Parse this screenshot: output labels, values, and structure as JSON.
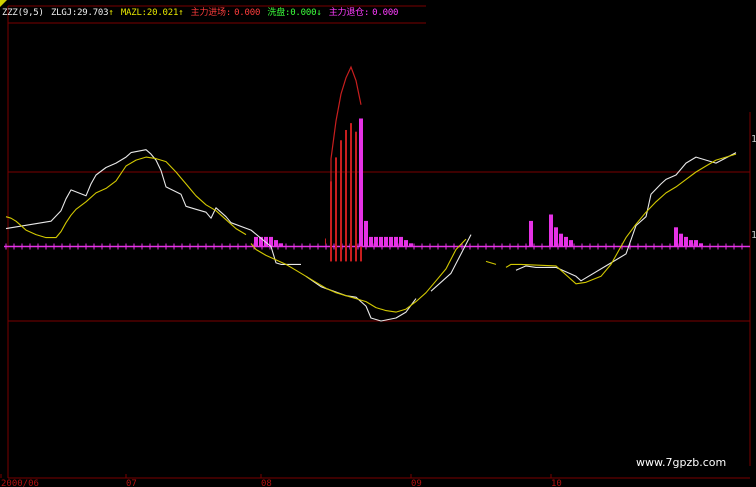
{
  "legend": {
    "indicator_name": "ZZZ(9,5)",
    "zlgj_label": "ZLGJ:",
    "zlgj_value": "29.703",
    "zlgj_arrow": "↑",
    "mazl_label": "MAZL:",
    "mazl_value": "20.021",
    "mazl_arrow": "↑",
    "main_force_entry_label": "主力进场:",
    "main_force_entry_value": "0.000",
    "flow_label": "洗盘:",
    "flow_value": "0.000",
    "flow_arrow": "↓",
    "main_force_exit_label": "主力退仓:",
    "main_force_exit_value": "0.000"
  },
  "x_axis": {
    "tick_labels": [
      "2000/06",
      "07",
      "08",
      "09",
      "10"
    ]
  },
  "right_axis": {
    "labels": [
      "1",
      "1"
    ]
  },
  "watermark": "www.7gpzb.com",
  "colors": {
    "background": "#000000",
    "white_line": "#e8e8e8",
    "yellow_line": "#d2c800",
    "red_bars": "#c81e1e",
    "magenta_bars": "#e632e6",
    "grid_red": "#7a0000",
    "legend_white": "#f0f0f0",
    "legend_yellow": "#e6e600",
    "legend_red": "#ff3c3c",
    "legend_green": "#3cff3c",
    "legend_magenta": "#ff3cff"
  },
  "chart_data": {
    "type": "line",
    "title": "",
    "x_tick_labels": [
      "2000/06",
      "07",
      "08",
      "09",
      "10"
    ],
    "levels": [
      100,
      50,
      0
    ],
    "series": [
      {
        "name": "ZLGJ",
        "color": "#e8e8e8",
        "points": [
          [
            0,
            62
          ],
          [
            9,
            67
          ],
          [
            11,
            74
          ],
          [
            12,
            82
          ],
          [
            13,
            88
          ],
          [
            16,
            84
          ],
          [
            17,
            92
          ],
          [
            18,
            98
          ],
          [
            20,
            103
          ],
          [
            22,
            106
          ],
          [
            24,
            110
          ],
          [
            25,
            113
          ],
          [
            28,
            115
          ],
          [
            29,
            112
          ],
          [
            30,
            108
          ],
          [
            31,
            101
          ],
          [
            32,
            90
          ],
          [
            35,
            85
          ],
          [
            36,
            77
          ],
          [
            38,
            75
          ],
          [
            40,
            73
          ],
          [
            41,
            69
          ],
          [
            42,
            76
          ],
          [
            44,
            70
          ],
          [
            45,
            66
          ],
          [
            49,
            61
          ],
          [
            53,
            50
          ],
          [
            54,
            39
          ],
          [
            55,
            38
          ],
          [
            59,
            38
          ],
          [
            60,
            30
          ],
          [
            63,
            23
          ],
          [
            68,
            17
          ],
          [
            70,
            16
          ],
          [
            72,
            10
          ],
          [
            73,
            2
          ],
          [
            75,
            0
          ],
          [
            78,
            2
          ],
          [
            80,
            6
          ],
          [
            82,
            15
          ],
          [
            85,
            20
          ],
          [
            89,
            32
          ],
          [
            93,
            58
          ],
          [
            95,
            42
          ],
          [
            102,
            34
          ],
          [
            104,
            37
          ],
          [
            106,
            36
          ],
          [
            110,
            36
          ],
          [
            114,
            30
          ],
          [
            115,
            27
          ],
          [
            120,
            37
          ],
          [
            124,
            45
          ],
          [
            126,
            64
          ],
          [
            128,
            70
          ],
          [
            129,
            85
          ],
          [
            131,
            92
          ],
          [
            132,
            95
          ],
          [
            134,
            98
          ],
          [
            136,
            106
          ],
          [
            138,
            110
          ],
          [
            142,
            106
          ],
          [
            146,
            113
          ]
        ],
        "segments": [
          [
            0,
            59
          ],
          [
            60,
            84
          ],
          [
            85,
            93
          ],
          [
            94,
            96
          ],
          [
            97,
            999
          ]
        ]
      },
      {
        "name": "MAZL",
        "color": "#d2c800",
        "points": [
          [
            0,
            70
          ],
          [
            1,
            69
          ],
          [
            2,
            67
          ],
          [
            3,
            64
          ],
          [
            4,
            61
          ],
          [
            6,
            58
          ],
          [
            8,
            56
          ],
          [
            10,
            56
          ],
          [
            11,
            60
          ],
          [
            12,
            66
          ],
          [
            13,
            71
          ],
          [
            14,
            75
          ],
          [
            16,
            80
          ],
          [
            18,
            86
          ],
          [
            20,
            89
          ],
          [
            22,
            94
          ],
          [
            24,
            104
          ],
          [
            26,
            108
          ],
          [
            28,
            110
          ],
          [
            30,
            109
          ],
          [
            32,
            107
          ],
          [
            34,
            100
          ],
          [
            35,
            96
          ],
          [
            36,
            92
          ],
          [
            37,
            88
          ],
          [
            38,
            84
          ],
          [
            40,
            78
          ],
          [
            42,
            74
          ],
          [
            44,
            68
          ],
          [
            46,
            62
          ],
          [
            48,
            58
          ],
          [
            49,
            52
          ],
          [
            50,
            48
          ],
          [
            52,
            44
          ],
          [
            54,
            41
          ],
          [
            56,
            38
          ],
          [
            58,
            34
          ],
          [
            60,
            30
          ],
          [
            62,
            26
          ],
          [
            64,
            22
          ],
          [
            66,
            19
          ],
          [
            68,
            17
          ],
          [
            70,
            15
          ],
          [
            72,
            13
          ],
          [
            74,
            9
          ],
          [
            76,
            7
          ],
          [
            78,
            6
          ],
          [
            80,
            8
          ],
          [
            82,
            13
          ],
          [
            84,
            19
          ],
          [
            86,
            27
          ],
          [
            88,
            35
          ],
          [
            90,
            48
          ],
          [
            92,
            55
          ],
          [
            96,
            40
          ],
          [
            98,
            38
          ],
          [
            100,
            36
          ],
          [
            101,
            38
          ],
          [
            103,
            38
          ],
          [
            110,
            37
          ],
          [
            114,
            25
          ],
          [
            116,
            26
          ],
          [
            119,
            30
          ],
          [
            121,
            38
          ],
          [
            123,
            50
          ],
          [
            124,
            56
          ],
          [
            126,
            65
          ],
          [
            128,
            73
          ],
          [
            130,
            80
          ],
          [
            132,
            86
          ],
          [
            134,
            90
          ],
          [
            136,
            95
          ],
          [
            138,
            100
          ],
          [
            140,
            104
          ],
          [
            142,
            108
          ],
          [
            144,
            110
          ],
          [
            146,
            112
          ]
        ],
        "segments": [
          [
            0,
            48
          ],
          [
            49,
            94
          ],
          [
            95,
            99
          ],
          [
            100,
            999
          ]
        ]
      }
    ],
    "histograms": [
      {
        "name": "主力进场",
        "color": "#c81e1e",
        "bars": [
          [
            65,
            38
          ],
          [
            66,
            52
          ],
          [
            67,
            62
          ],
          [
            68,
            68
          ],
          [
            69,
            72
          ],
          [
            70,
            67
          ],
          [
            71,
            58
          ]
        ],
        "small_bars": [
          [
            64,
            3
          ],
          [
            65,
            3
          ],
          [
            66,
            3
          ],
          [
            67,
            3
          ],
          [
            68,
            3
          ],
          [
            69,
            3
          ],
          [
            70,
            3
          ]
        ]
      },
      {
        "name": "主力退仓",
        "color": "#e632e6",
        "bars": [
          [
            71,
            40
          ],
          [
            72,
            8
          ],
          [
            50,
            3
          ],
          [
            51,
            3
          ],
          [
            52,
            3
          ],
          [
            53,
            3
          ],
          [
            54,
            2
          ],
          [
            55,
            1
          ],
          [
            71,
            3
          ],
          [
            72,
            3
          ],
          [
            73,
            3
          ],
          [
            74,
            3
          ],
          [
            75,
            3
          ],
          [
            76,
            3
          ],
          [
            77,
            3
          ],
          [
            78,
            3
          ],
          [
            79,
            3
          ],
          [
            80,
            2
          ],
          [
            81,
            1
          ],
          [
            105,
            8
          ],
          [
            109,
            10
          ],
          [
            110,
            6
          ],
          [
            111,
            4
          ],
          [
            112,
            3
          ],
          [
            113,
            2
          ],
          [
            134,
            6
          ],
          [
            135,
            4
          ],
          [
            136,
            3
          ],
          [
            137,
            2
          ],
          [
            138,
            2
          ],
          [
            139,
            1
          ]
        ]
      }
    ]
  }
}
